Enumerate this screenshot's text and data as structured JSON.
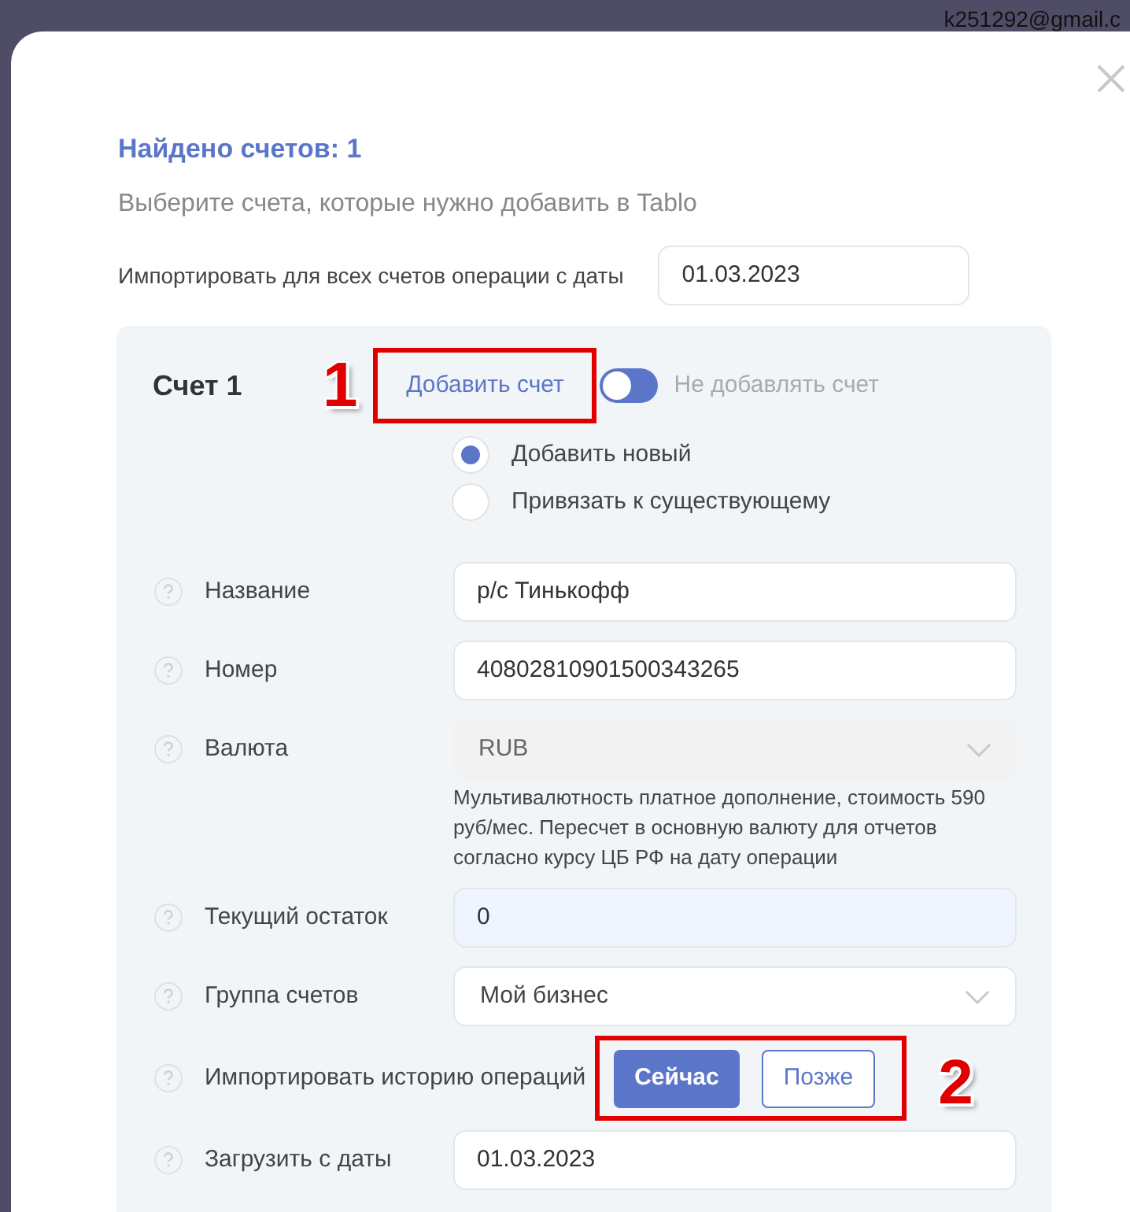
{
  "header": {
    "email": "k251292@gmail.c"
  },
  "modal": {
    "title": "Найдено счетов: 1",
    "subtitle": "Выберите счета, которые нужно добавить в Tablo",
    "import_all": {
      "label": "Импортировать для всех счетов операции с даты",
      "value": "01.03.2023"
    }
  },
  "account": {
    "title": "Счет 1",
    "add_link": "Добавить счет",
    "toggle": {
      "on": false
    },
    "toggle_label": "Не добавлять счет",
    "radios": [
      {
        "label": "Добавить новый",
        "selected": true
      },
      {
        "label": "Привязать к существующему",
        "selected": false
      }
    ],
    "fields": [
      {
        "kind": "input",
        "label": "Название",
        "value": "р/с Тинькофф"
      },
      {
        "kind": "input",
        "label": "Номер",
        "value": "40802810901500343265"
      },
      {
        "kind": "select",
        "label": "Валюта",
        "value": "RUB",
        "disabled": true,
        "note": "Мультивалютность платное дополнение, стоимость 590 руб/мес. Пересчет в основную валюту для отчетов согласно курсу ЦБ РФ на дату операции"
      },
      {
        "kind": "input",
        "label": "Текущий остаток",
        "value": "0",
        "highlighted": true
      },
      {
        "kind": "select",
        "label": "Группа счетов",
        "value": "Мой бизнес",
        "disabled": false
      },
      {
        "kind": "buttons",
        "label": "Импортировать историю операций",
        "buttons": [
          {
            "label": "Сейчас",
            "selected": true
          },
          {
            "label": "Позже",
            "selected": false
          }
        ]
      },
      {
        "kind": "input",
        "label": "Загрузить с даты",
        "value": "01.03.2023"
      }
    ]
  },
  "callouts": [
    {
      "number": "1"
    },
    {
      "number": "2"
    }
  ]
}
